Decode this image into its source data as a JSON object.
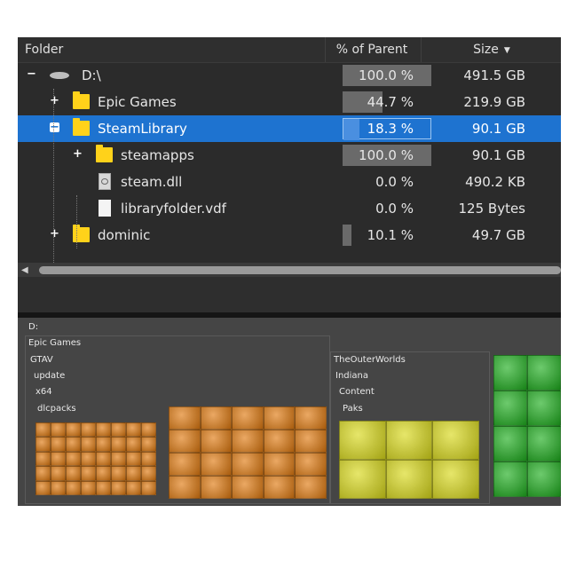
{
  "header": {
    "folder_label": "Folder",
    "pct_label": "% of Parent",
    "size_label": "Size",
    "sort_indicator": "▼"
  },
  "rows": [
    {
      "name": "D:\\",
      "icon": "drive-icon",
      "expander": "−",
      "pct": "100.0 %",
      "pct_value": 100.0,
      "size": "491.5 GB",
      "selected": false
    },
    {
      "name": "Epic Games",
      "icon": "folder-icon",
      "expander": "+",
      "pct": "44.7 %",
      "pct_value": 44.7,
      "size": "219.9 GB",
      "selected": false
    },
    {
      "name": "SteamLibrary",
      "icon": "folder-icon",
      "expander": "−",
      "pct": "18.3 %",
      "pct_value": 18.3,
      "size": "90.1 GB",
      "selected": true
    },
    {
      "name": "steamapps",
      "icon": "folder-icon",
      "expander": "+",
      "pct": "100.0 %",
      "pct_value": 100.0,
      "size": "90.1 GB",
      "selected": false
    },
    {
      "name": "steam.dll",
      "icon": "dll-file-icon",
      "expander": "",
      "pct": "0.0 %",
      "pct_value": 0.0,
      "size": "490.2 KB",
      "selected": false
    },
    {
      "name": "libraryfolder.vdf",
      "icon": "file-icon",
      "expander": "",
      "pct": "0.0 %",
      "pct_value": 0.0,
      "size": "125 Bytes",
      "selected": false
    },
    {
      "name": "dominic",
      "icon": "folder-icon",
      "expander": "+",
      "pct": "10.1 %",
      "pct_value": 10.1,
      "size": "49.7 GB",
      "selected": false
    }
  ],
  "scrollbar": {
    "left_arrow": "◀"
  },
  "treemap": {
    "path_labels": [
      "D:",
      "Epic Games",
      "GTAV",
      "update",
      "x64",
      "dlcpacks",
      "TheOuterWorlds",
      "Indiana",
      "Content",
      "Paks"
    ],
    "colors": {
      "orange": "#e07a10",
      "yellow": "#d9d91a",
      "green": "#1fae1f"
    }
  }
}
